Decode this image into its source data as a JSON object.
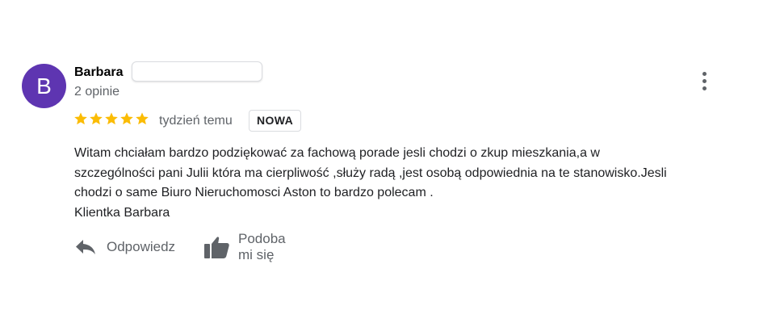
{
  "review": {
    "author": {
      "initial": "B",
      "name": "Barbara",
      "review_count": "2 opinie",
      "avatar_color": "#5e35b1"
    },
    "rating": 5,
    "star_color": "#fbbc04",
    "date": "tydzień temu",
    "badge": "NOWA",
    "text_lines": [
      "Witam chciałam bardzo podziękować za fachową porade jesli chodzi o zkup mieszkania,a w",
      "szczególności pani Julii która ma cierpliwość ,służy radą ,jest osobą odpowiednia na te stanowisko.Jesli",
      "chodzi o same Biuro Nieruchomosci Aston to bardzo polecam .",
      "Klientka Barbara"
    ],
    "actions": {
      "reply_label": "Odpowiedz",
      "reply_icon": "reply-icon",
      "like_label": "Podoba mi się",
      "like_icon": "thumb-up-icon"
    },
    "more_icon": "more-vert-icon"
  }
}
